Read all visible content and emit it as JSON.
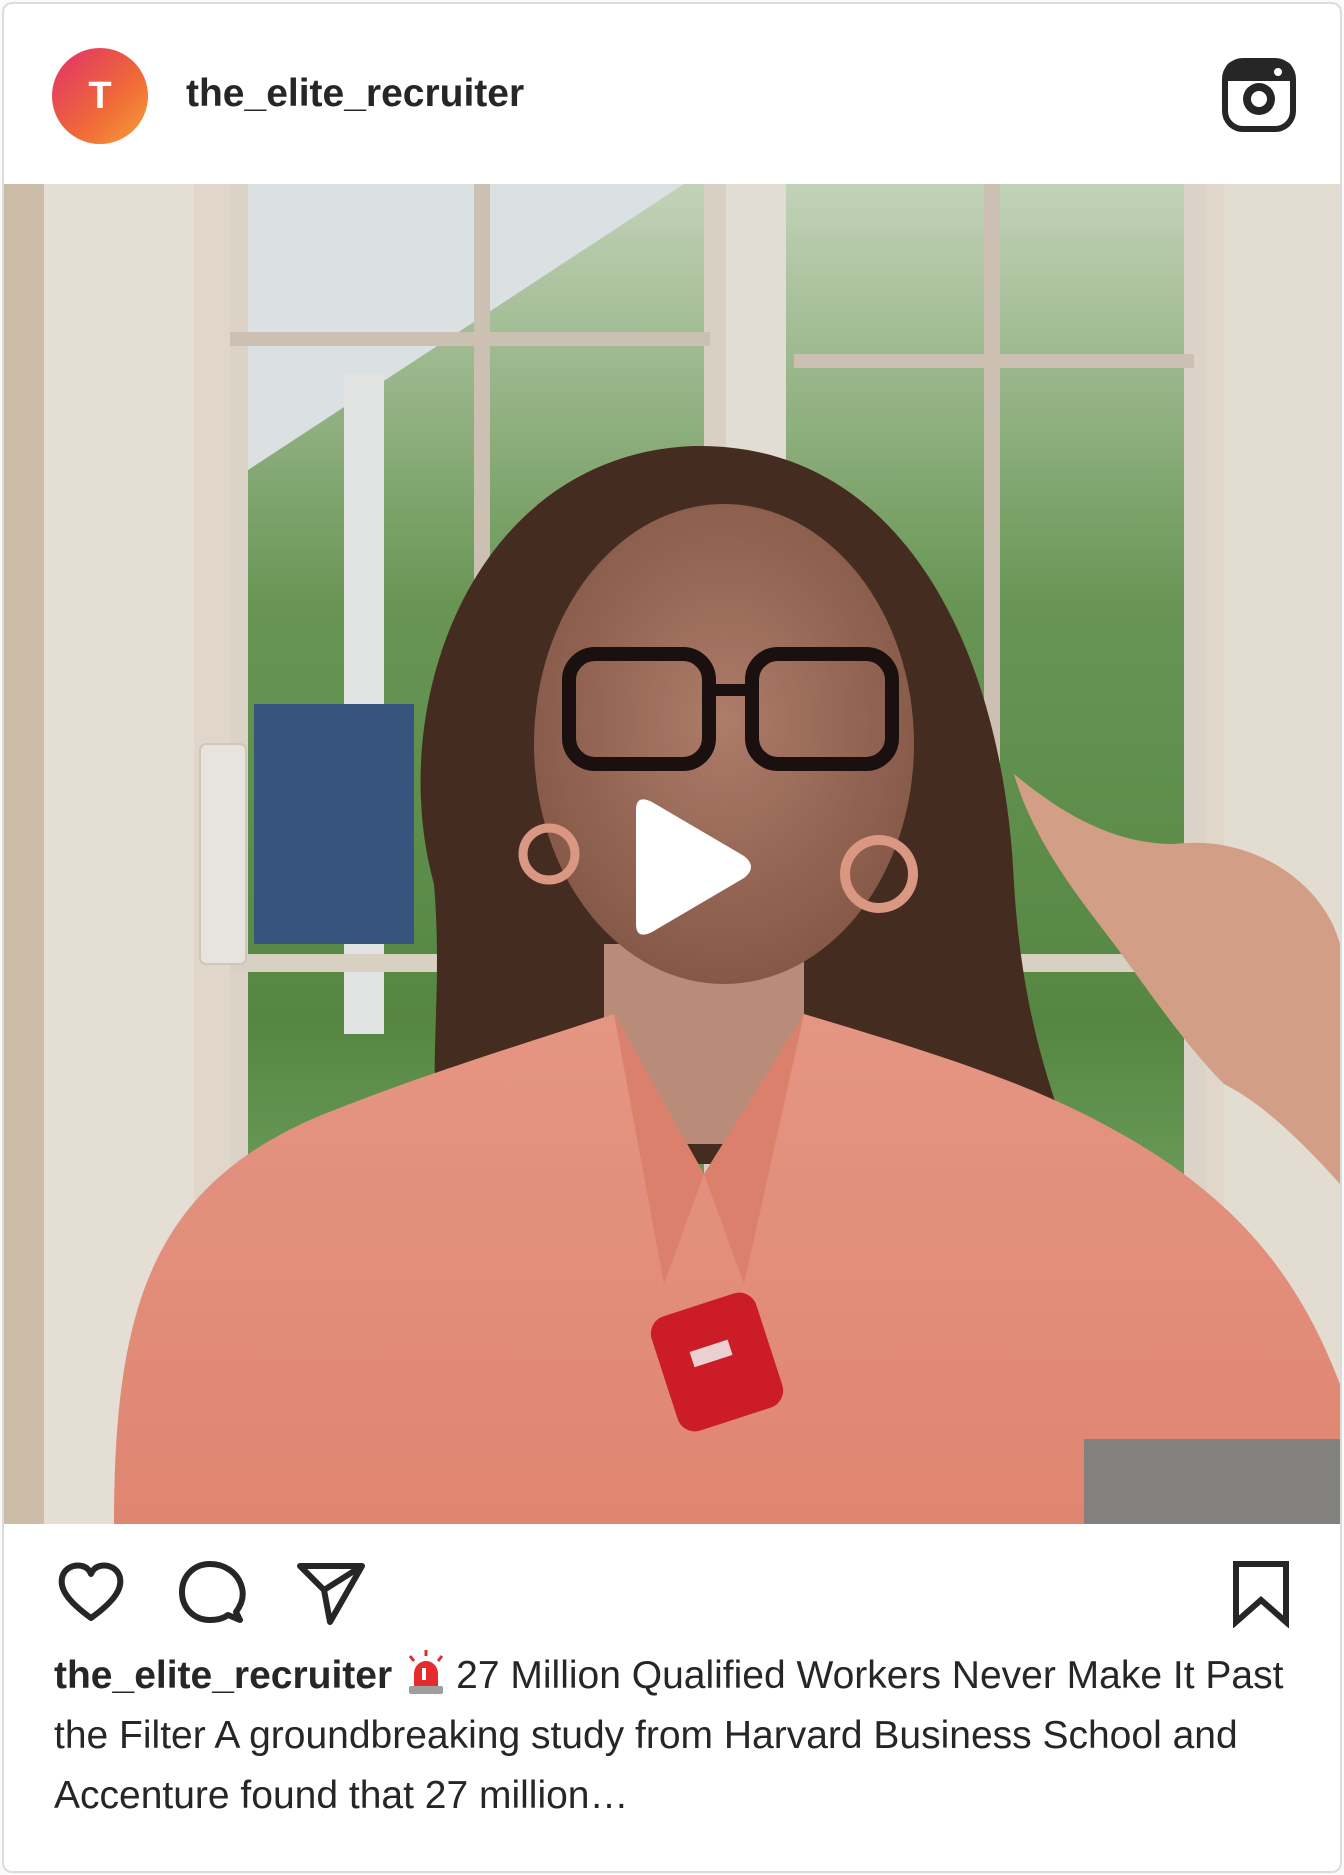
{
  "header": {
    "avatar_letter": "T",
    "username": "the_elite_recruiter"
  },
  "media": {
    "type": "video",
    "play_icon": "play-icon"
  },
  "actions": {
    "like_icon": "heart-icon",
    "comment_icon": "comment-icon",
    "share_icon": "send-icon",
    "save_icon": "bookmark-icon"
  },
  "caption": {
    "username": "the_elite_recruiter",
    "emoji_icon": "siren-icon",
    "text": "27 Million Qualified Workers Never Make It Past the Filter A groundbreaking study from Harvard Business School and Accenture found that 27 million…"
  },
  "colors": {
    "avatar_gradient_start": "#e1306c",
    "avatar_gradient_end": "#f8a03b",
    "text": "#262626",
    "border": "#dbdbdb"
  }
}
